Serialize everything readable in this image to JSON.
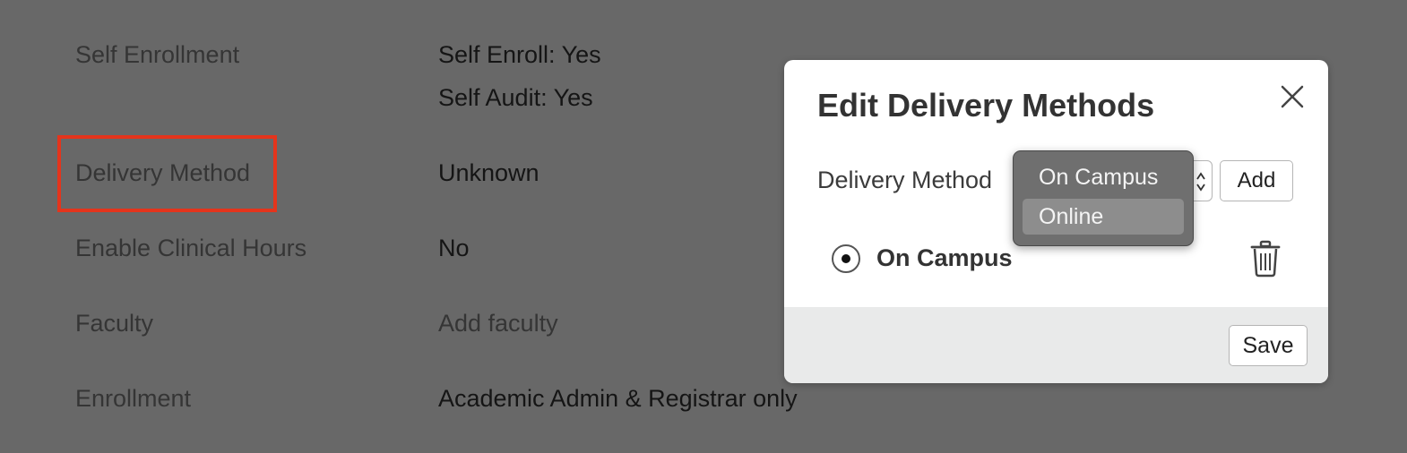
{
  "details": {
    "self_enrollment_label": "Self Enrollment",
    "self_enroll_value": "Self Enroll: Yes",
    "self_audit_value": "Self Audit: Yes",
    "delivery_method_label": "Delivery Method",
    "delivery_method_value": "Unknown",
    "clinical_hours_label": "Enable Clinical Hours",
    "clinical_hours_value": "No",
    "faculty_label": "Faculty",
    "faculty_link": "Add faculty",
    "enrollment_label": "Enrollment",
    "enrollment_value": "Academic Admin & Registrar only"
  },
  "modal": {
    "title": "Edit Delivery Methods",
    "close_icon": "close-icon",
    "field_label": "Delivery Method",
    "add_label": "Add",
    "methods": [
      {
        "name": "On Campus",
        "selected": true
      }
    ],
    "trash_icon": "trash-icon",
    "save_label": "Save"
  },
  "dropdown": {
    "options": [
      "On Campus",
      "Online"
    ],
    "highlighted": "Online"
  },
  "colors": {
    "overlay": "#686868",
    "highlight_border": "#e4341c",
    "modal_footer": "#e9eaea"
  }
}
